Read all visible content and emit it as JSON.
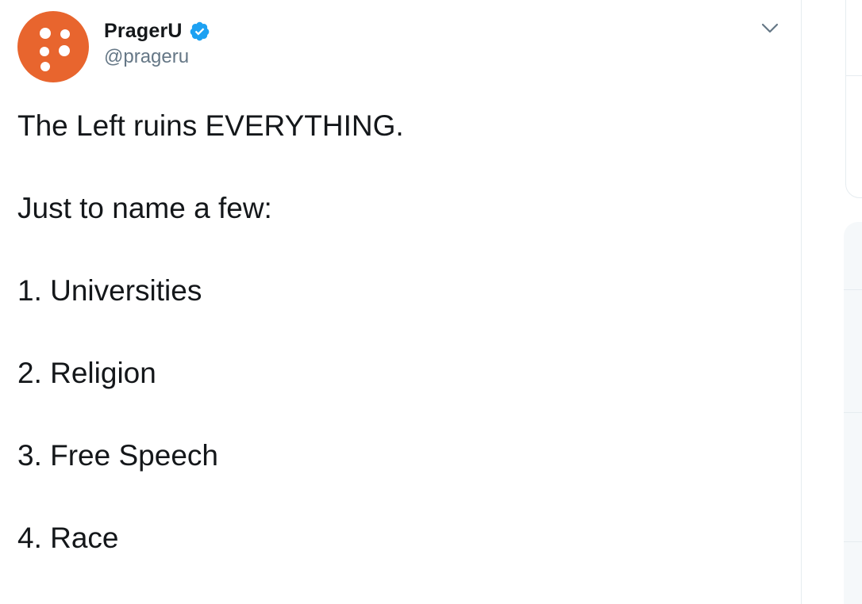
{
  "tweet": {
    "author": {
      "display_name": "PragerU",
      "handle": "@prageru",
      "verified": true,
      "avatar_icon": "prageru-logo-icon",
      "avatar_color": "#e8652e"
    },
    "menu_icon": "chevron-down-icon",
    "lines": [
      "The Left ruins EVERYTHING.",
      "Just to name a few:",
      "1. Universities",
      "2. Religion",
      "3. Free Speech",
      "4. Race"
    ]
  },
  "colors": {
    "verified_badge": "#1da1f2",
    "text_primary": "#14171a",
    "text_secondary": "#657786",
    "border": "#e6ecf0",
    "sidebar_background": "#f5f8fa"
  }
}
